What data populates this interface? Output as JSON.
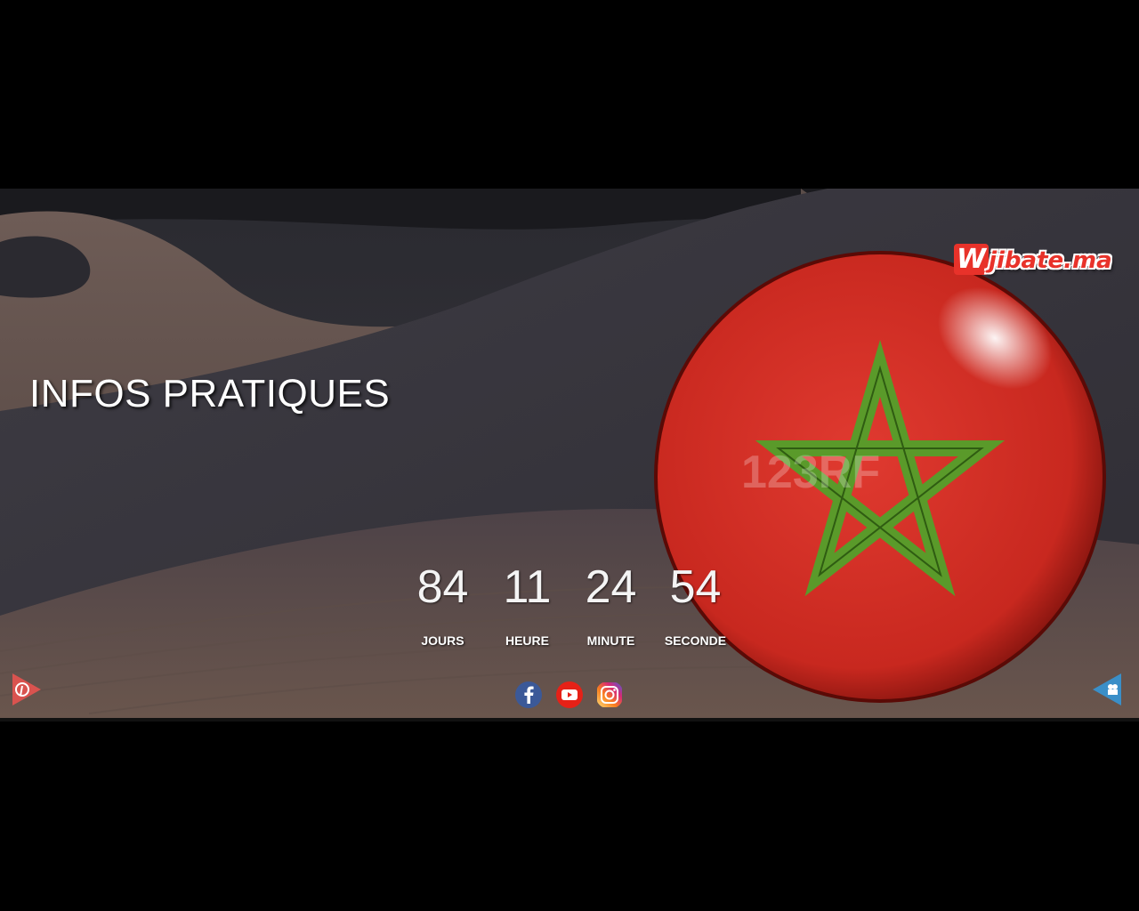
{
  "page": {
    "title": "INFOS PRATIQUES"
  },
  "brand": {
    "logo_prefix": "W",
    "logo_text": "jibate.ma"
  },
  "countdown": [
    {
      "value": "84",
      "label": "JOURS"
    },
    {
      "value": "11",
      "label": "HEURE"
    },
    {
      "value": "24",
      "label": "MINUTE"
    },
    {
      "value": "54",
      "label": "SECONDE"
    }
  ],
  "social": [
    {
      "name": "facebook",
      "icon": "facebook-icon",
      "color": "#3b5998"
    },
    {
      "name": "youtube",
      "icon": "youtube-icon",
      "color": "#e62117"
    },
    {
      "name": "instagram",
      "icon": "instagram-icon",
      "color": "#c13584"
    }
  ],
  "watermark": "123RF",
  "colors": {
    "flag_red": "#d4302a",
    "star_green": "#5a9a2a",
    "background": "#000000"
  }
}
